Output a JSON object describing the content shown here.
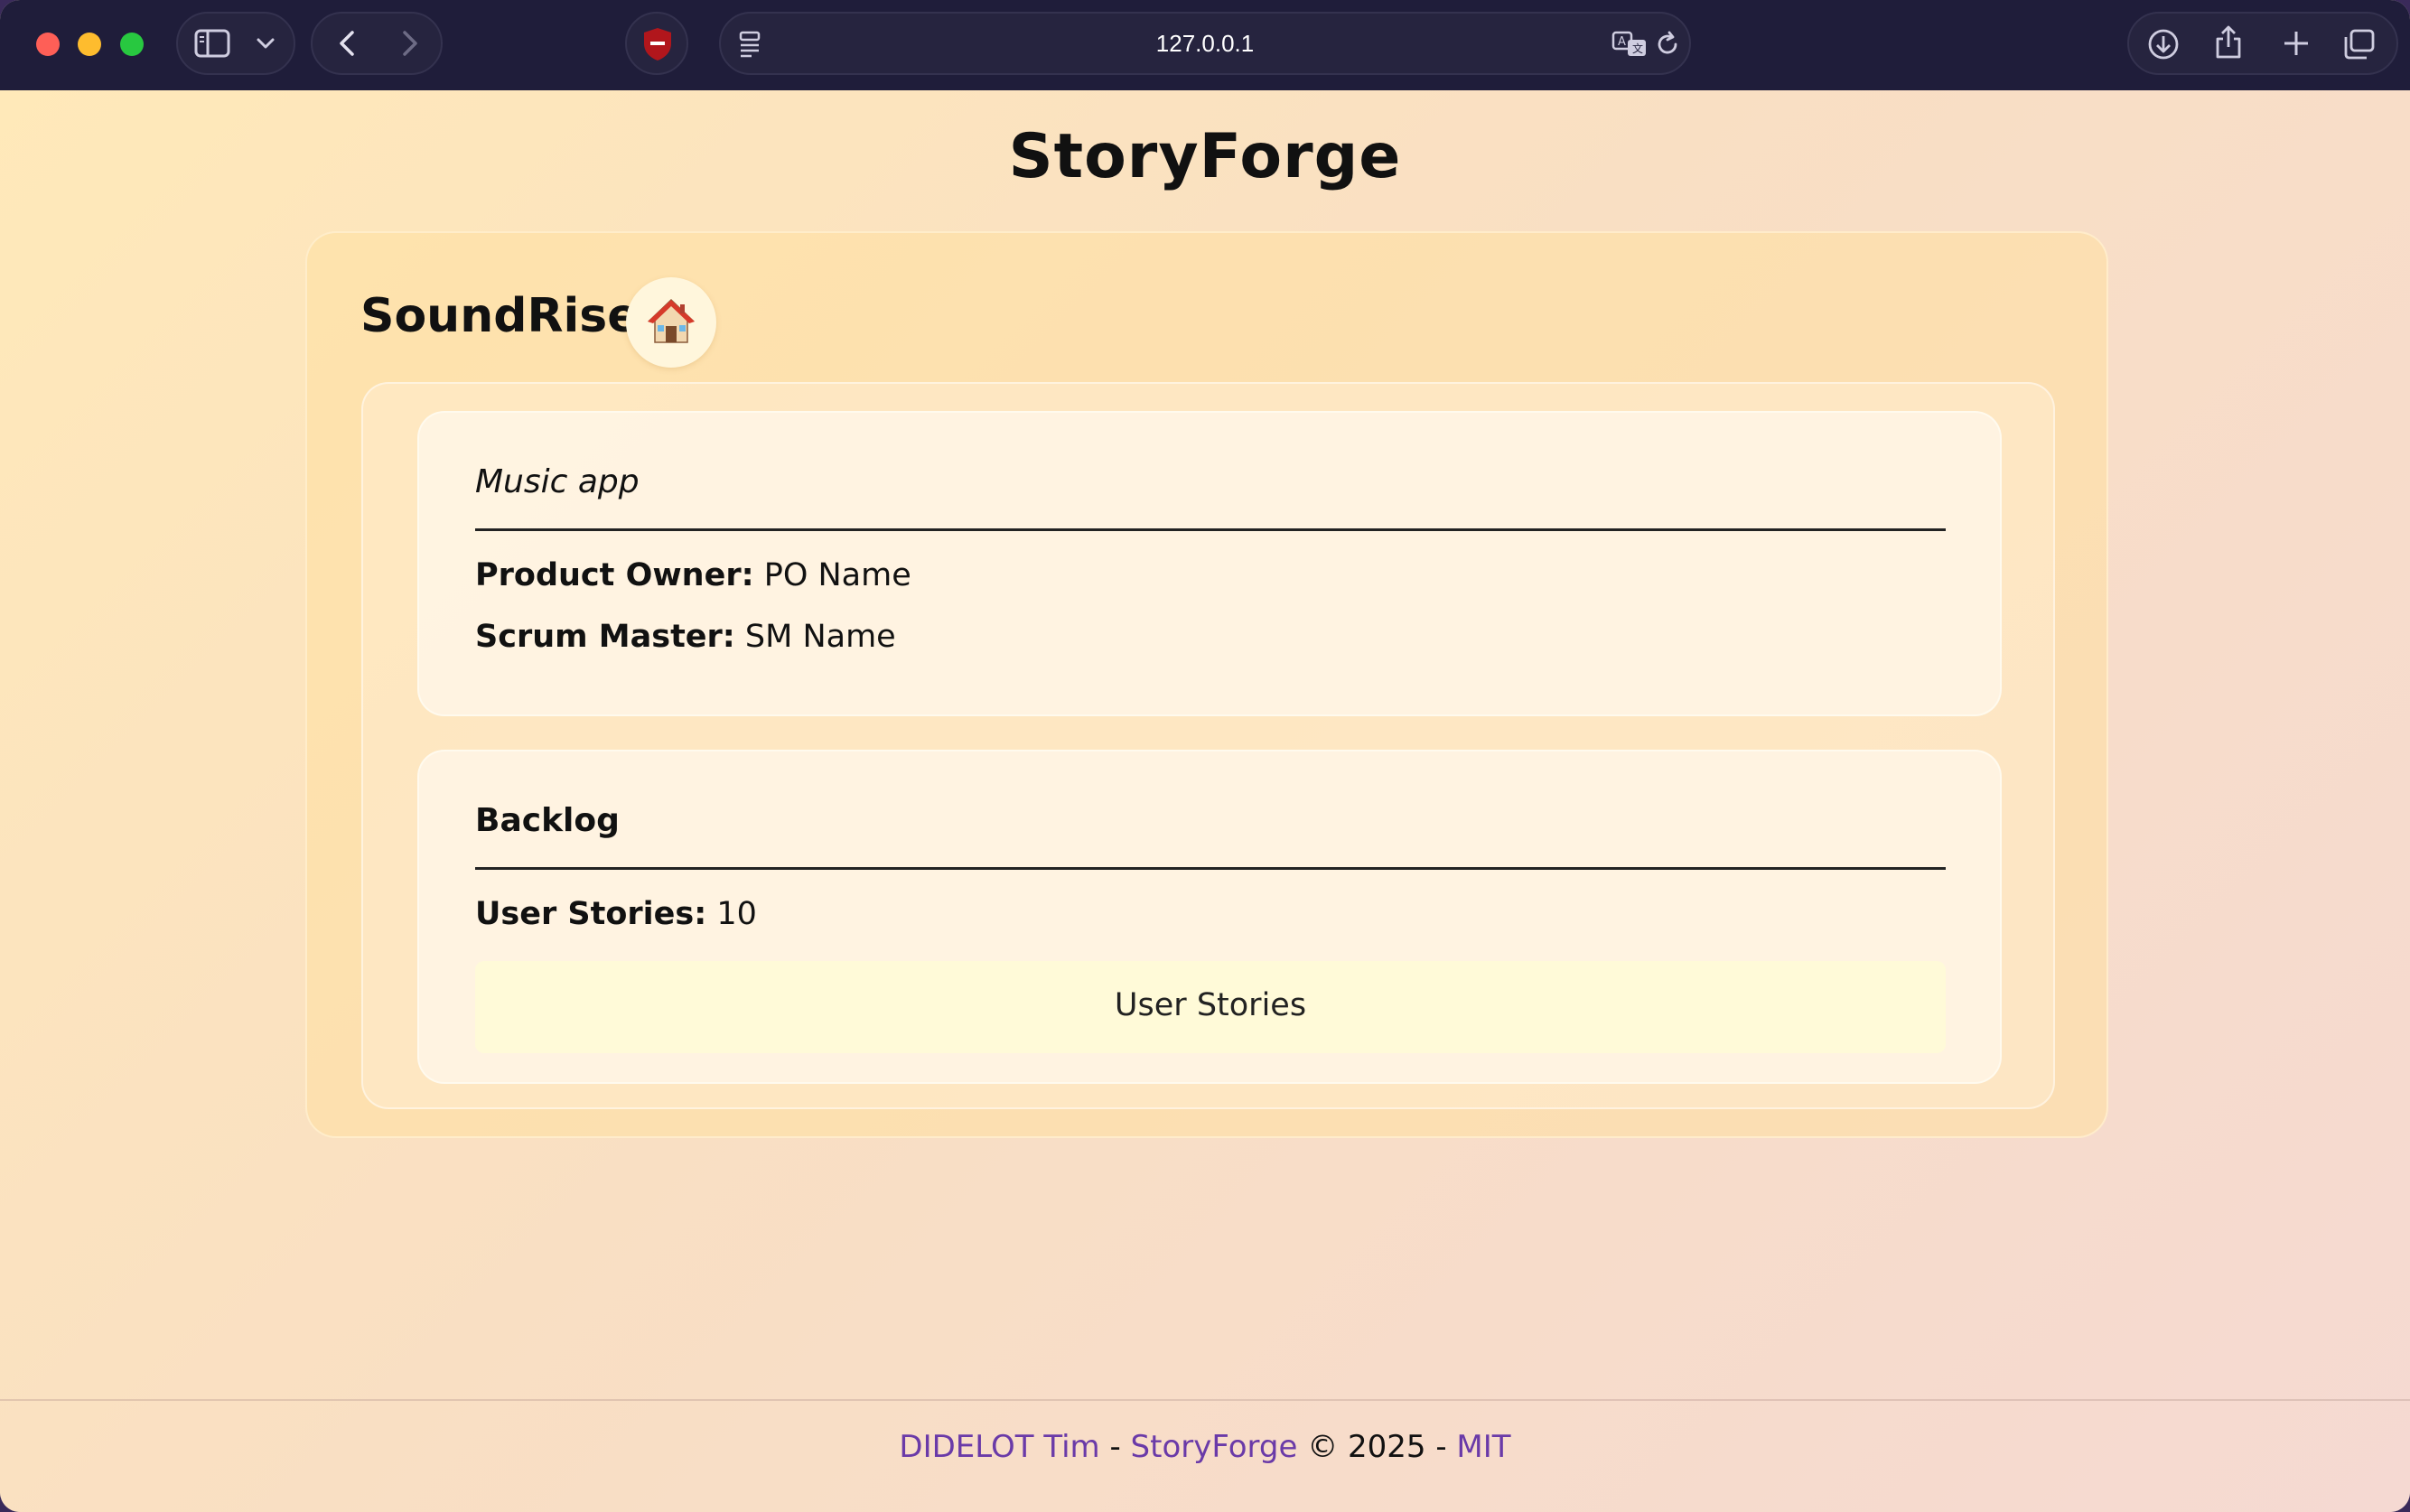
{
  "browser": {
    "url": "127.0.0.1"
  },
  "site": {
    "title": "StoryForge"
  },
  "project": {
    "name": "SoundRise",
    "home_icon": "house-emoji-icon",
    "description": "Music app",
    "product_owner_label": "Product Owner:",
    "product_owner_value": " PO Name",
    "scrum_master_label": "Scrum Master:",
    "scrum_master_value": " SM Name"
  },
  "backlog": {
    "heading": "Backlog",
    "user_stories_label": "User Stories:",
    "user_stories_count": " 10",
    "button_label": "User Stories"
  },
  "footer": {
    "author": "DIDELOT Tim",
    "sep1": " - ",
    "project_link": "StoryForge",
    "copyright": " © 2025 - ",
    "license": "MIT"
  },
  "colors": {
    "toolbar_bg": "#1f1d3a",
    "link": "#6a3aa8",
    "button_bg": "#fffad8"
  }
}
